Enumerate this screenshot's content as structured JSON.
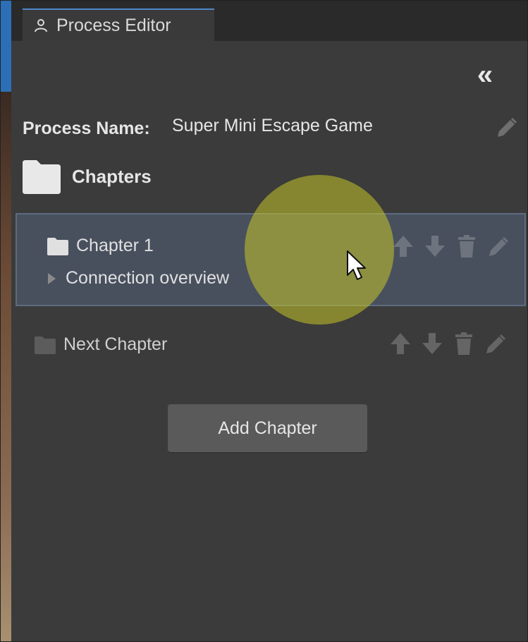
{
  "window": {
    "tab_title": "Process Editor",
    "tab_icon": "person-icon",
    "collapse_label": "«",
    "accent_color": "#4f86c9"
  },
  "process": {
    "label": "Process Name:",
    "value": "Super Mini Escape Game",
    "edit_icon": "pencil-icon"
  },
  "chapters": {
    "title": "Chapters",
    "icon": "folder-icon",
    "items": [
      {
        "name": "Chapter 1",
        "selected": true,
        "sub_label": "Connection overview",
        "actions": [
          "arrow-up-icon",
          "arrow-down-icon",
          "trash-icon",
          "pencil-icon"
        ]
      },
      {
        "name": "Next Chapter",
        "selected": false,
        "actions": [
          "arrow-up-icon",
          "arrow-down-icon",
          "trash-icon",
          "pencil-icon"
        ]
      }
    ],
    "add_button_label": "Add Chapter"
  },
  "colors": {
    "panel_bg": "#3b3b3b",
    "selected_bg": "#48505e",
    "highlight": "#c4c428"
  }
}
